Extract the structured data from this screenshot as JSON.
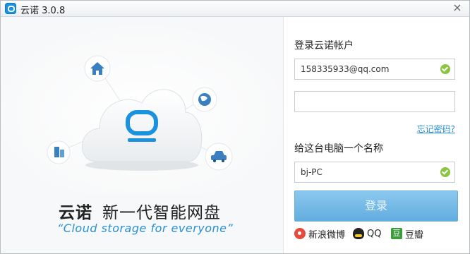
{
  "window": {
    "title": "云诺 3.0.8",
    "close_glyph": "×"
  },
  "left": {
    "brand": "云诺",
    "tagline": "新一代智能网盘",
    "slogan_en": "“Cloud storage for everyone”",
    "icons": [
      "house-icon",
      "globe-icon",
      "building-icon",
      "car-icon",
      "cloud-logo-icon"
    ]
  },
  "login": {
    "account_label": "登录云诺帐户",
    "account_value": "158335933@qq.com",
    "account_valid": true,
    "password_value": "",
    "forgot_password": "忘记密码?",
    "computer_name_label": "给这台电脑一个名称",
    "computer_name_value": "bj-PC",
    "computer_name_valid": true,
    "submit_label": "登录"
  },
  "social_login": [
    {
      "label": "新浪微博",
      "icon": "weibo-icon"
    },
    {
      "label": "QQ",
      "icon": "qq-icon"
    },
    {
      "label": "豆瓣",
      "icon": "douban-icon"
    }
  ],
  "colors": {
    "accent": "#2a8fd4",
    "button": "#62ade0",
    "valid": "#8bc441",
    "brand_blue": "#1a92dd"
  }
}
